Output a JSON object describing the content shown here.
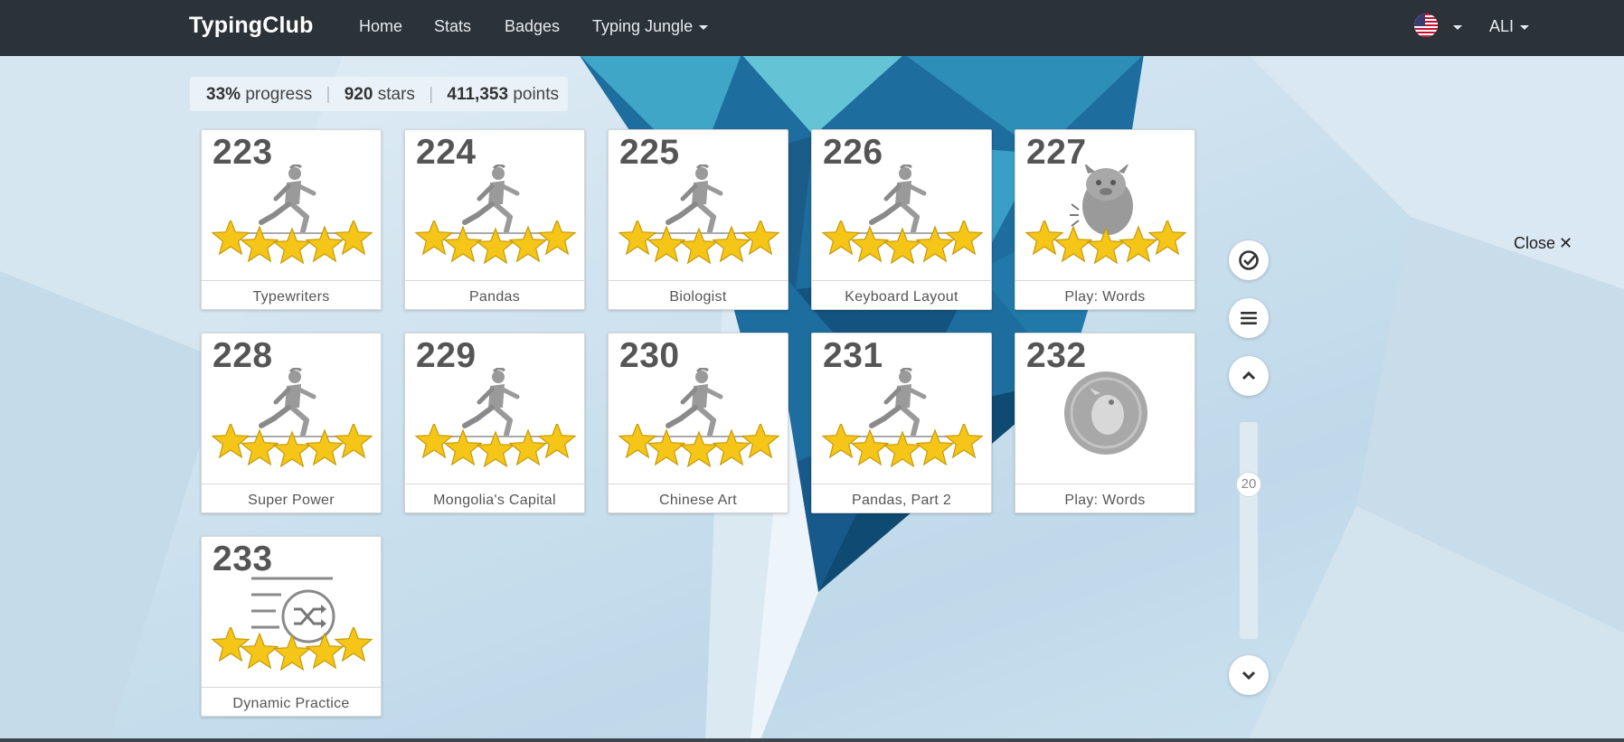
{
  "nav": {
    "brand": "TypingClub",
    "links": [
      "Home",
      "Stats",
      "Badges",
      "Typing Jungle"
    ],
    "user": "ALI"
  },
  "stats": {
    "progress_value": "33%",
    "progress_label": "progress",
    "stars_value": "920",
    "stars_label": "stars",
    "points_value": "411,353",
    "points_label": "points"
  },
  "lessons": [
    {
      "number": "223",
      "title": "Typewriters",
      "icon": "runner-icon",
      "stars": 5
    },
    {
      "number": "224",
      "title": "Pandas",
      "icon": "runner-icon",
      "stars": 5
    },
    {
      "number": "225",
      "title": "Biologist",
      "icon": "runner-icon",
      "stars": 5
    },
    {
      "number": "226",
      "title": "Keyboard Layout",
      "icon": "runner-icon",
      "stars": 5
    },
    {
      "number": "227",
      "title": "Play: Words",
      "icon": "monster-icon",
      "stars": 5
    },
    {
      "number": "228",
      "title": "Super Power",
      "icon": "runner-icon",
      "stars": 5
    },
    {
      "number": "229",
      "title": "Mongolia's Capital",
      "icon": "runner-icon",
      "stars": 5
    },
    {
      "number": "230",
      "title": "Chinese Art",
      "icon": "runner-icon",
      "stars": 5
    },
    {
      "number": "231",
      "title": "Pandas, Part 2",
      "icon": "runner-icon",
      "stars": 5
    },
    {
      "number": "232",
      "title": "Play: Words",
      "icon": "locked-game-icon",
      "stars": 0
    },
    {
      "number": "233",
      "title": "Dynamic Practice",
      "icon": "shuffle-icon",
      "stars": 5
    }
  ],
  "controls": {
    "scroll_position": "20",
    "close_label": "Close"
  },
  "colors": {
    "navbar": "#2b3238",
    "star": "#f5c518",
    "card_number": "#555555"
  }
}
